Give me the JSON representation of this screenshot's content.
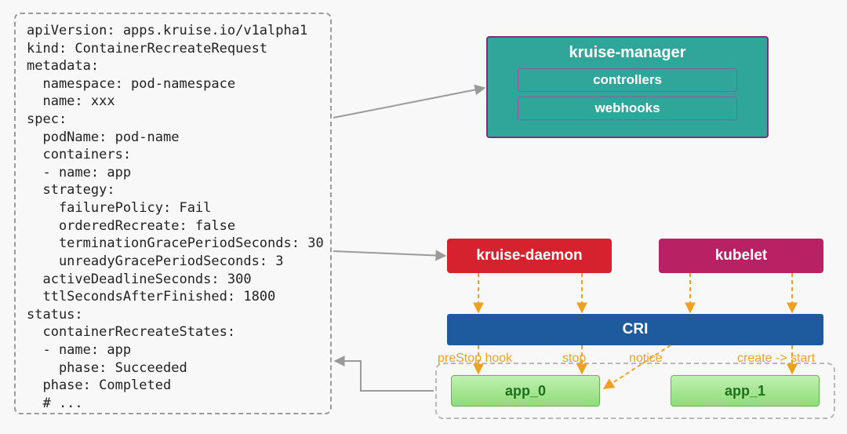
{
  "yaml": {
    "lines": [
      "apiVersion: apps.kruise.io/v1alpha1",
      "kind: ContainerRecreateRequest",
      "metadata:",
      "  namespace: pod-namespace",
      "  name: xxx",
      "spec:",
      "  podName: pod-name",
      "  containers:",
      "  - name: app",
      "  strategy:",
      "    failurePolicy: Fail",
      "    orderedRecreate: false",
      "    terminationGracePeriodSeconds: 30",
      "    unreadyGracePeriodSeconds: 3",
      "  activeDeadlineSeconds: 300",
      "  ttlSecondsAfterFinished: 1800",
      "status:",
      "  containerRecreateStates:",
      "  - name: app",
      "    phase: Succeeded",
      "  phase: Completed",
      "  # ..."
    ]
  },
  "diagram": {
    "kruise_manager": {
      "title": "kruise-manager",
      "controllers": "controllers",
      "webhooks": "webhooks"
    },
    "kruise_daemon": "kruise-daemon",
    "kubelet": "kubelet",
    "cri": "CRI",
    "apps": {
      "app0": "app_0",
      "app1": "app_1"
    },
    "flow_labels": {
      "prestop": "preStop hook",
      "stop": "stop",
      "notice": "notice",
      "create_start": "create -> start"
    }
  },
  "colors": {
    "teal": "#2fa699",
    "red": "#d5222e",
    "magenta": "#b82265",
    "blue": "#1e5a9e",
    "orange": "#f0a020",
    "green_grad_top": "#bff0b1",
    "green_grad_bot": "#8fdd77"
  }
}
